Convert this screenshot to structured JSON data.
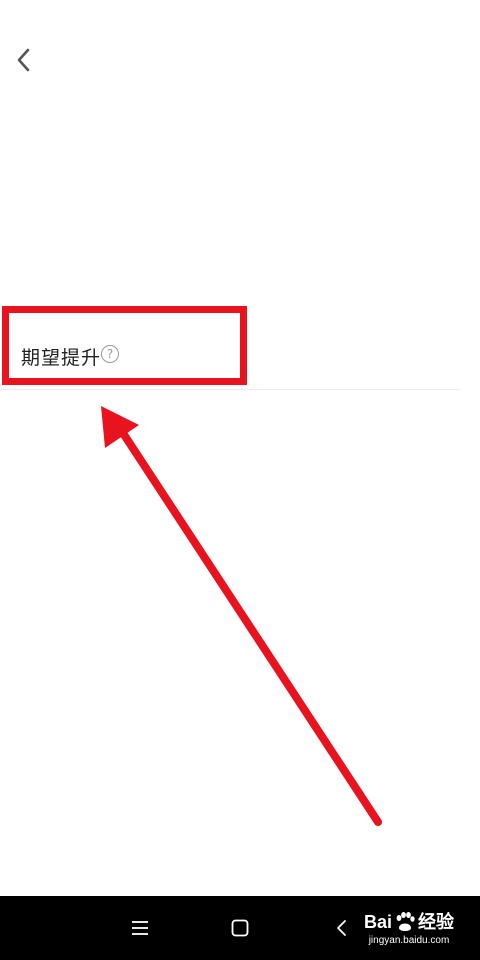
{
  "header": {
    "back_icon": "chevron-left-icon"
  },
  "setting_row": {
    "label": "期望提升",
    "help_icon": "question-circle-icon",
    "help_glyph": "?"
  },
  "annotation": {
    "highlight_color": "#e8131f",
    "arrow_color": "#e8131f"
  },
  "nav_bar": {
    "menu_icon": "menu-lines-icon",
    "home_icon": "square-home-icon",
    "back_icon": "triangle-back-icon"
  },
  "watermark": {
    "brand_left": "Bai",
    "brand_right": "经验",
    "url": "jingyan.baidu.com",
    "paw_icon": "baidu-paw-icon"
  },
  "colors": {
    "background": "#ffffff",
    "text": "#222222",
    "divider": "#ececec",
    "nav_background": "#000000"
  }
}
